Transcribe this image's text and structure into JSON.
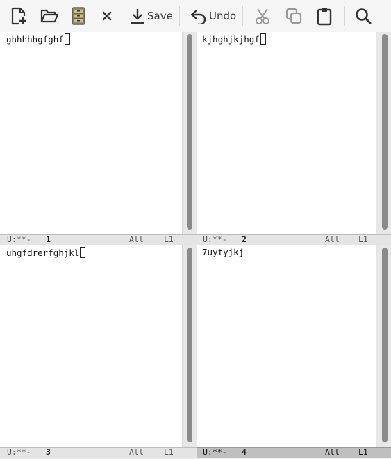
{
  "toolbar": {
    "new_icon": "new-file-icon",
    "open_icon": "open-folder-icon",
    "dired_icon": "file-cabinet-icon",
    "close_icon": "close-icon",
    "save_label": "Save",
    "undo_label": "Undo",
    "cut_icon": "scissors-icon",
    "copy_icon": "copy-icon",
    "paste_icon": "clipboard-icon",
    "search_icon": "search-icon"
  },
  "windows": [
    {
      "text": "ghhhhhgfghf",
      "cursor": true,
      "status": "U:**-",
      "buffer": "1",
      "position": "All",
      "line": "L1",
      "active": false
    },
    {
      "text": "kjhghjkjhgf",
      "cursor": true,
      "status": "U:**-",
      "buffer": "2",
      "position": "All",
      "line": "L1",
      "active": false
    },
    {
      "text": "uhgfdrerfghjkl",
      "cursor": true,
      "status": "U:**-",
      "buffer": "3",
      "position": "All",
      "line": "L1",
      "active": false
    },
    {
      "text": "7uytyjkj",
      "cursor": false,
      "status": "U:**-",
      "buffer": "4",
      "position": "All",
      "line": "L1",
      "active": true
    }
  ]
}
